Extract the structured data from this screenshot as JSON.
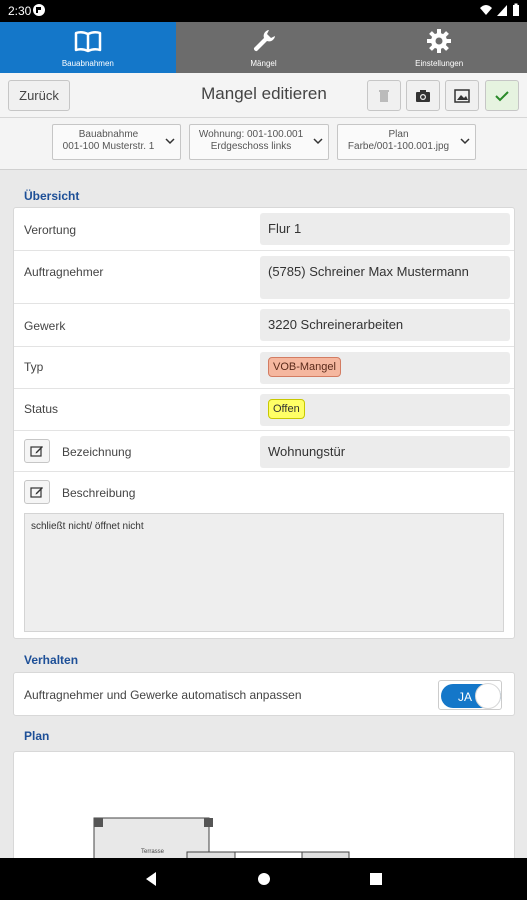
{
  "status_bar": {
    "time": "2:30"
  },
  "tabs": [
    {
      "label": "Bauabnahmen",
      "icon": "book-icon",
      "active": true
    },
    {
      "label": "Mängel",
      "icon": "wrench-icon",
      "active": false
    },
    {
      "label": "Einstellungen",
      "icon": "gear-icon",
      "active": false
    }
  ],
  "toolbar": {
    "back_label": "Zurück",
    "title": "Mangel editieren",
    "icons": [
      "trash-icon",
      "camera-icon",
      "image-icon",
      "check-icon"
    ]
  },
  "selectors": [
    {
      "line1": "Bauabnahme",
      "line2": "001-100 Musterstr. 1"
    },
    {
      "line1": "Wohnung: 001-100.001",
      "line2": "Erdgeschoss links"
    },
    {
      "line1": "Plan",
      "line2": "Farbe/001-100.001.jpg"
    }
  ],
  "overview": {
    "title": "Übersicht",
    "rows": {
      "verortung": {
        "label": "Verortung",
        "value": "Flur 1"
      },
      "auftragnehmer": {
        "label": "Auftragnehmer",
        "value": "(5785) Schreiner Max Mustermann"
      },
      "gewerk": {
        "label": "Gewerk",
        "value": "3220 Schreinerarbeiten"
      },
      "typ": {
        "label": "Typ",
        "value": "VOB-Mangel",
        "color": "#f5b79f"
      },
      "status": {
        "label": "Status",
        "value": "Offen",
        "color": "#ffff66"
      },
      "bezeichnung": {
        "label": "Bezeichnung",
        "value": "Wohnungstür"
      },
      "beschreibung": {
        "label": "Beschreibung",
        "value": "schließt nicht/ öffnet nicht"
      }
    }
  },
  "verhalten": {
    "title": "Verhalten",
    "auto_label": "Auftragnehmer und Gewerke automatisch anpassen",
    "toggle_label": "JA",
    "toggle_on": true
  },
  "plan": {
    "title": "Plan",
    "room_label": "Terrasse"
  },
  "colors": {
    "accent": "#1477c9",
    "section_title": "#1d4f97"
  }
}
